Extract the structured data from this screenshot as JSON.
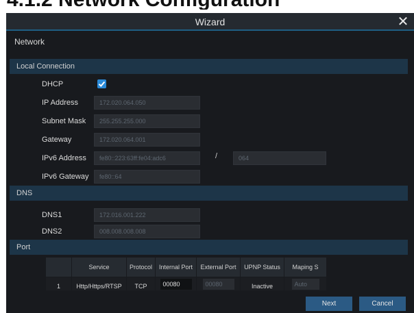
{
  "page_heading": "4.1.2 Network Configuration",
  "dialog": {
    "title": "Wizard",
    "close_glyph": "✕",
    "section_title": "Network"
  },
  "local_connection": {
    "header": "Local Connection",
    "dhcp_label": "DHCP",
    "dhcp_checked": true,
    "ip_address_label": "IP Address",
    "ip_address_value": "172.020.064.050",
    "subnet_mask_label": "Subnet Mask",
    "subnet_mask_value": "255.255.255.000",
    "gateway_label": "Gateway",
    "gateway_value": "172.020.064.001",
    "ipv6_address_label": "IPv6 Address",
    "ipv6_address_value": "fe80::223:63ff:fe04:adc6",
    "ipv6_separator": "/",
    "ipv6_prefix_value": "064",
    "ipv6_gateway_label": "IPv6 Gateway",
    "ipv6_gateway_value": "fe80::64"
  },
  "dns": {
    "header": "DNS",
    "dns1_label": "DNS1",
    "dns1_value": "172.016.001.222",
    "dns2_label": "DNS2",
    "dns2_value": "008.008.008.008"
  },
  "port": {
    "header": "Port",
    "columns": [
      "",
      "Service",
      "Protocol",
      "Internal Port",
      "External Port",
      "UPNP Status",
      "Maping S"
    ],
    "rows": [
      {
        "index": "1",
        "service": "Http/Https/RTSP",
        "protocol": "TCP",
        "internal_port": "00080",
        "external_port": "00080",
        "upnp_status": "Inactive",
        "mapping": "Auto"
      }
    ]
  },
  "footer": {
    "next_label": "Next",
    "cancel_label": "Cancel"
  },
  "colors": {
    "accent": "#2a8ad8",
    "section_bar": "#1d3548",
    "button": "#2b5a84"
  },
  "icons": {
    "close": "close-icon",
    "checkbox": "checkmark-icon"
  }
}
